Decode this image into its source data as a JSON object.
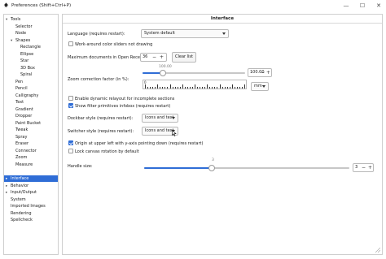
{
  "window": {
    "title": "Preferences (Shift+Ctrl+P)",
    "minimize_glyph": "—",
    "maximize_glyph": "☐",
    "close_glyph": "✕"
  },
  "tree": [
    {
      "label": "Tools",
      "arrow": "▾"
    },
    {
      "label": "Selector",
      "arrow": ""
    },
    {
      "label": "Node",
      "arrow": ""
    },
    {
      "label": "Shapes",
      "arrow": "▾"
    },
    {
      "label": "Rectangle",
      "arrow": ""
    },
    {
      "label": "Ellipse",
      "arrow": ""
    },
    {
      "label": "Star",
      "arrow": ""
    },
    {
      "label": "3D Box",
      "arrow": ""
    },
    {
      "label": "Spiral",
      "arrow": ""
    },
    {
      "label": "Pen",
      "arrow": ""
    },
    {
      "label": "Pencil",
      "arrow": ""
    },
    {
      "label": "Calligraphy",
      "arrow": ""
    },
    {
      "label": "Text",
      "arrow": ""
    },
    {
      "label": "Gradient",
      "arrow": ""
    },
    {
      "label": "Dropper",
      "arrow": ""
    },
    {
      "label": "Paint Bucket",
      "arrow": ""
    },
    {
      "label": "Tweak",
      "arrow": ""
    },
    {
      "label": "Spray",
      "arrow": ""
    },
    {
      "label": "Eraser",
      "arrow": ""
    },
    {
      "label": "Connector",
      "arrow": ""
    },
    {
      "label": "Zoom",
      "arrow": ""
    },
    {
      "label": "Measure",
      "arrow": ""
    },
    {
      "label": "Interface",
      "arrow": "▸",
      "selected": true
    },
    {
      "label": "Behavior",
      "arrow": "▸"
    },
    {
      "label": "Input/Output",
      "arrow": "▸"
    },
    {
      "label": "System",
      "arrow": ""
    },
    {
      "label": "Imported Images",
      "arrow": ""
    },
    {
      "label": "Rendering",
      "arrow": ""
    },
    {
      "label": "Spellcheck",
      "arrow": ""
    }
  ],
  "panel": {
    "header": "Interface",
    "language_label": "Language (requires restart):",
    "language_value": "System default",
    "workaround_label": "Work-around color sliders not drawing",
    "workaround_checked": false,
    "max_docs_label": "Maximum documents in Open Recent:",
    "max_docs_value": "36",
    "clear_list_label": "Clear list",
    "zoom_label": "Zoom correction factor (in %):",
    "zoom_slider_top_value": "100.00",
    "zoom_value": "100.00",
    "zoom_slider_fraction": 0.2,
    "ruler_zero": "0",
    "unit_value": "mm",
    "dynamic_relayout_label": "Enable dynamic relayout for incomplete sections",
    "dynamic_relayout_checked": false,
    "show_filter_label": "Show filter primitives infobox (requires restart)",
    "show_filter_checked": true,
    "dockbar_label": "Dockbar style (requires restart):",
    "dockbar_value": "Icons and text",
    "switcher_label": "Switcher style (requires restart):",
    "switcher_value": "Icons and text",
    "origin_label": "Origin at upper left with y-axis pointing down (requires restart)",
    "origin_checked": true,
    "lock_rotation_label": "Lock canvas rotation by default",
    "lock_rotation_checked": false,
    "handle_size_label": "Handle size:",
    "handle_size_slider_top_value": "3",
    "handle_size_value": "3",
    "handle_size_fraction": 0.33
  },
  "colors": {
    "accent": "#2f6dd6"
  }
}
